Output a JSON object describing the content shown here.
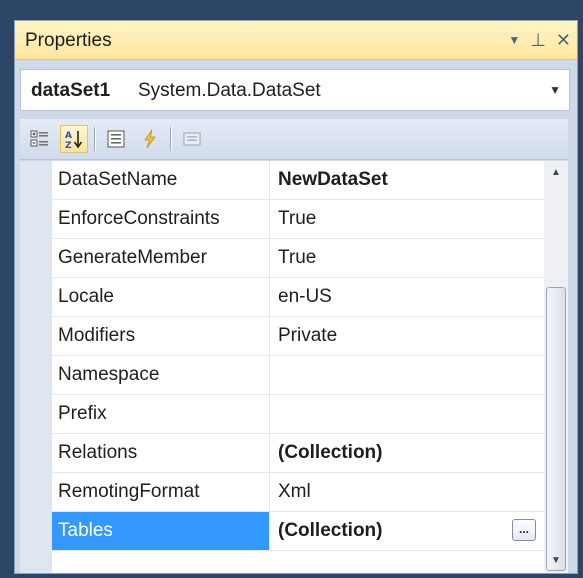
{
  "window": {
    "title": "Properties",
    "icons": [
      "dropdown-icon",
      "pin-icon",
      "close-icon"
    ],
    "dropdown_glyph": "▼",
    "pin_glyph": "⊥",
    "close_glyph": "✕"
  },
  "object_selector": {
    "name": "dataSet1",
    "type": "System.Data.DataSet"
  },
  "toolbar": {
    "buttons": [
      "categorized-icon",
      "alphabetical-icon",
      "properties-icon",
      "events-icon",
      "property-pages-icon"
    ],
    "active": "alphabetical-icon"
  },
  "properties": [
    {
      "name": "DataSetName",
      "value": "NewDataSet",
      "bold": true
    },
    {
      "name": "EnforceConstraints",
      "value": "True",
      "bold": false
    },
    {
      "name": "GenerateMember",
      "value": "True",
      "bold": false
    },
    {
      "name": "Locale",
      "value": "en-US",
      "bold": false
    },
    {
      "name": "Modifiers",
      "value": "Private",
      "bold": false
    },
    {
      "name": "Namespace",
      "value": "",
      "bold": false
    },
    {
      "name": "Prefix",
      "value": "",
      "bold": false
    },
    {
      "name": "Relations",
      "value": "(Collection)",
      "bold": true
    },
    {
      "name": "RemotingFormat",
      "value": "Xml",
      "bold": false
    },
    {
      "name": "Tables",
      "value": "(Collection)",
      "bold": true,
      "selected": true,
      "ellipsis": "..."
    }
  ],
  "colors": {
    "selection": "#3399ff",
    "title_bar": "#ffe6a0",
    "frame": "#2d4567"
  }
}
